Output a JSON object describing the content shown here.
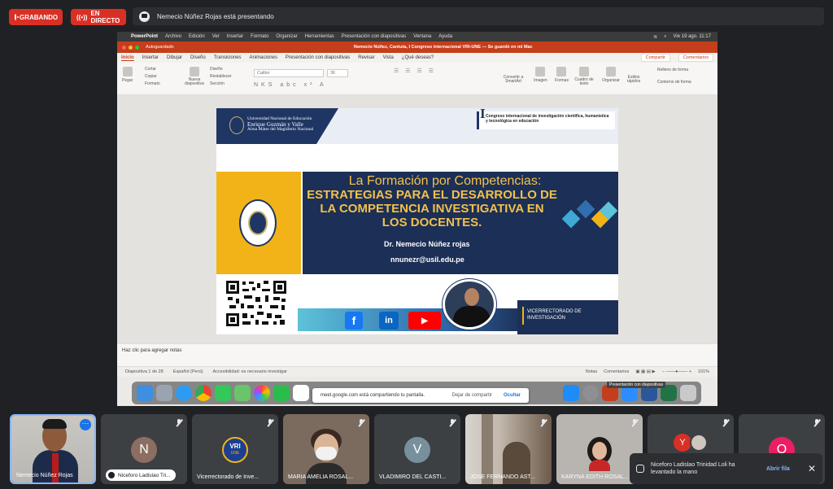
{
  "top_bar": {
    "recording_label": "GRABANDO",
    "live_label": "EN DIRECTO",
    "presenting_text": "Nemecio Núñez Rojas está presentando"
  },
  "mac": {
    "app_name": "PowerPoint",
    "menu": [
      "Archivo",
      "Edición",
      "Ver",
      "Insertar",
      "Formato",
      "Organizar",
      "Herramientas",
      "Presentación con diapositivas",
      "Ventana",
      "Ayuda"
    ],
    "clock": "Vie 19 ago.  11:17"
  },
  "ppt": {
    "autosave_label": "Autoguardado",
    "doc_title": "Nemecio Núñez, Cantuta, I Congreso internacional VRI-UNE — Se guardó en mi Mac",
    "tabs": [
      "Inicio",
      "Insertar",
      "Dibujar",
      "Diseño",
      "Transiciones",
      "Animaciones",
      "Presentación con diapositivas",
      "Revisar",
      "Vista",
      "¿Qué deseas?"
    ],
    "share_label": "Compartir",
    "comments_label": "Comentarios",
    "ribbon": {
      "paste": "Pegar",
      "cut": "Cortar",
      "copy": "Copiar",
      "format": "Formato",
      "new_slide": "Nueva diapositiva",
      "layout": "Diseño",
      "reset": "Restablecer",
      "section": "Sección",
      "font_name": "Calibri",
      "font_size": "36",
      "convert_smartart": "Convertir a SmartArt",
      "image": "Imagen",
      "shapes": "Formas",
      "textbox": "Cuadro de texto",
      "arrange": "Organizar",
      "quick_styles": "Estilos rápidos",
      "shape_fill": "Relleno de forma",
      "shape_outline": "Contorno de forma"
    },
    "notes_placeholder": "Haz clic para agregar notas",
    "status": {
      "slide_count": "Diapositiva 1 de 28",
      "language": "Español (Perú)",
      "accessibility": "Accesibilidad: es necesario investigar",
      "notes": "Notas",
      "comments": "Comentarios",
      "zoom": "101%",
      "tooltip": "Presentación con diapositivas"
    }
  },
  "slide": {
    "university_line1": "Universidad Nacional de Educación",
    "university_line2": "Enrique Guzmán y Valle",
    "university_line3": "Alma Máter del Magisterio Nacional",
    "congress_numeral": "I",
    "congress_text": "Congreso internacional de investigación científica, humanística y tecnológica en educación",
    "title_line1": "La Formación por Competencias:",
    "title_line2": "ESTRATEGIAS PARA EL DESARROLLO DE LA COMPETENCIA INVESTIGATIVA EN LOS DOCENTES.",
    "author": "Dr. Nemecio Núñez rojas",
    "email": "nnunezr@usil.edu.pe",
    "vicer_line1": "VICERRECTORADO DE",
    "vicer_line2": "INVESTIGACIÓN",
    "social_facebook": "f",
    "social_linkedin": "in"
  },
  "screen_share": {
    "sharing_text": "meet.google.com está compartiendo tu pantalla.",
    "stop_label": "Dejar de compartir",
    "hide_label": "Ocultar"
  },
  "participants": [
    {
      "name": "Nemecio Núñez Rojas"
    },
    {
      "initial": "N",
      "name": "Niceforo Ladislao Tri...",
      "color": "#8d6e63"
    },
    {
      "initial": "VRI",
      "sub": "UNE",
      "name": "Vicerrectorado de Inve..."
    },
    {
      "name": "MARIA AMELIA ROSAL..."
    },
    {
      "initial": "V",
      "name": "VLADIMIRO DEL CASTI...",
      "color": "#78909c"
    },
    {
      "name": "JOSE FERNANDO AST..."
    },
    {
      "name": "KARYNA EDITH ROSAL..."
    },
    {
      "initial": "Y",
      "color": "#d93025"
    },
    {
      "initial": "O",
      "color": "#e91e63"
    }
  ],
  "toast": {
    "text": "Niceforo Ladislao Trinidad Loli ha levantado la mano",
    "open_label": "Abrir fila"
  },
  "colors": {
    "record_red": "#d93025",
    "ppt_orange": "#c43e1c",
    "navy": "#1c2f56",
    "gold": "#f2b319",
    "highlight_blue": "#8ab4f8"
  }
}
